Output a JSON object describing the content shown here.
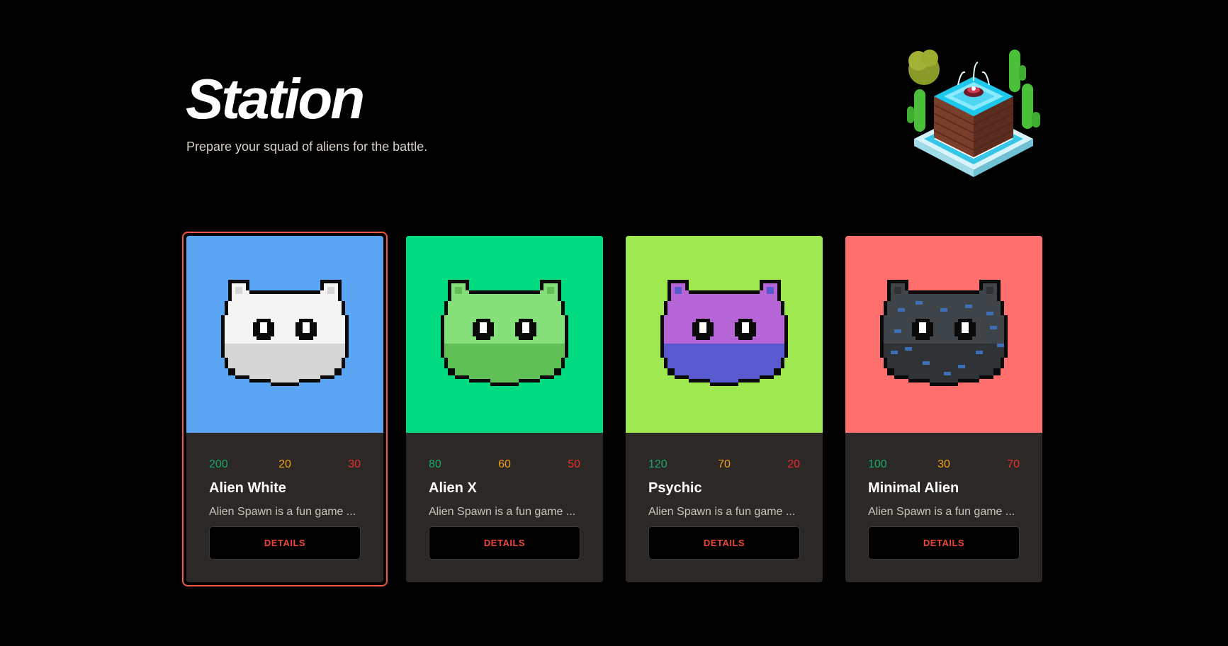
{
  "header": {
    "title": "Station",
    "subtitle": "Prepare your squad of aliens for the battle."
  },
  "logo": {
    "icon": "isometric-fountain-icon"
  },
  "cards": [
    {
      "name": "Alien White",
      "hp": "200",
      "attack": "20",
      "defense": "30",
      "description": "Alien Spawn is a fun game ...",
      "button_label": "DETAILS",
      "background": "#5aa6f5",
      "body_color": "#f4f4f4",
      "shade_color": "#d6d6d6",
      "selected": true
    },
    {
      "name": "Alien X",
      "hp": "80",
      "attack": "60",
      "defense": "50",
      "description": "Alien Spawn is a fun game ...",
      "button_label": "DETAILS",
      "background": "#00db82",
      "body_color": "#86e07a",
      "shade_color": "#5fc055",
      "selected": false
    },
    {
      "name": "Psychic",
      "hp": "120",
      "attack": "70",
      "defense": "20",
      "description": "Alien Spawn is a fun game ...",
      "button_label": "DETAILS",
      "background": "#9fe850",
      "body_color": "#b565d6",
      "shade_color": "#5a5ad0",
      "selected": false
    },
    {
      "name": "Minimal Alien",
      "hp": "100",
      "attack": "30",
      "defense": "70",
      "description": "Alien Spawn is a fun game ...",
      "button_label": "DETAILS",
      "background": "#ff6f6d",
      "body_color": "#3f4448",
      "shade_color": "#2f3336",
      "selected": false
    }
  ],
  "colors": {
    "hp": "#18a868",
    "attack": "#f2a118",
    "defense": "#e83030",
    "accent": "#f0553f",
    "card_bg": "#2c2825"
  }
}
